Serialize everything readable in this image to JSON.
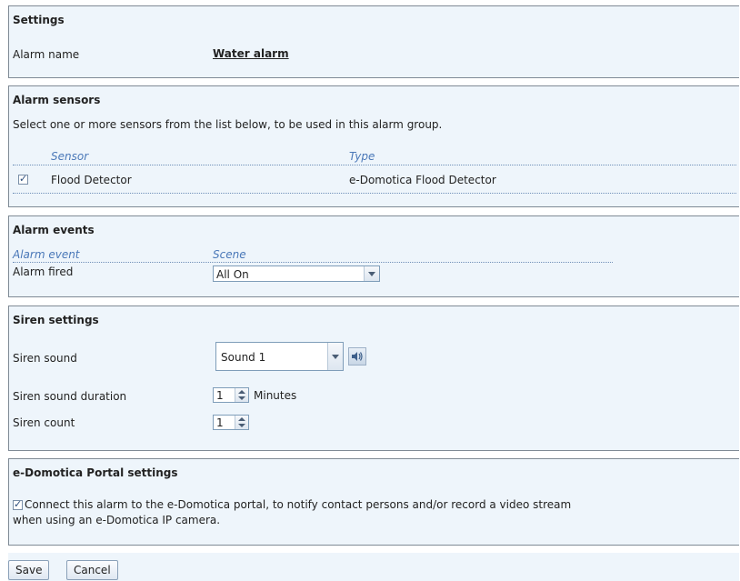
{
  "settings": {
    "title": "Settings",
    "alarm_name_label": "Alarm name",
    "alarm_name_value": "Water alarm"
  },
  "sensors": {
    "title": "Alarm sensors",
    "description": "Select one or more sensors from the list below, to be used in this alarm group.",
    "col_sensor": "Sensor",
    "col_type": "Type",
    "rows": [
      {
        "name": "Flood Detector",
        "type": "e-Domotica Flood Detector",
        "checked": true
      }
    ]
  },
  "events": {
    "title": "Alarm events",
    "col_event": "Alarm event",
    "col_scene": "Scene",
    "rows": [
      {
        "event": "Alarm fired",
        "scene": "All On"
      }
    ]
  },
  "siren": {
    "title": "Siren settings",
    "sound_label": "Siren sound",
    "sound_value": "Sound 1",
    "duration_label": "Siren sound duration",
    "duration_value": "1",
    "duration_unit": "Minutes",
    "count_label": "Siren count",
    "count_value": "1"
  },
  "portal": {
    "title": "e-Domotica Portal settings",
    "connect_text_line1": "Connect this alarm to the e-Domotica portal, to notify contact persons and/or record a video stream",
    "connect_text_line2": "when using an e-Domotica IP camera.",
    "connect_checked": true
  },
  "actions": {
    "save_label": "Save",
    "cancel_label": "Cancel"
  },
  "icons": {
    "checkbox": "checkbox-checked-icon",
    "dropdown": "chevron-down-icon",
    "speaker": "speaker-icon",
    "spinner": "spinner-arrows-icon"
  },
  "colors": {
    "panel_bg": "#eef5fb",
    "column_header": "#4a78b8",
    "border": "#7f8a95"
  }
}
